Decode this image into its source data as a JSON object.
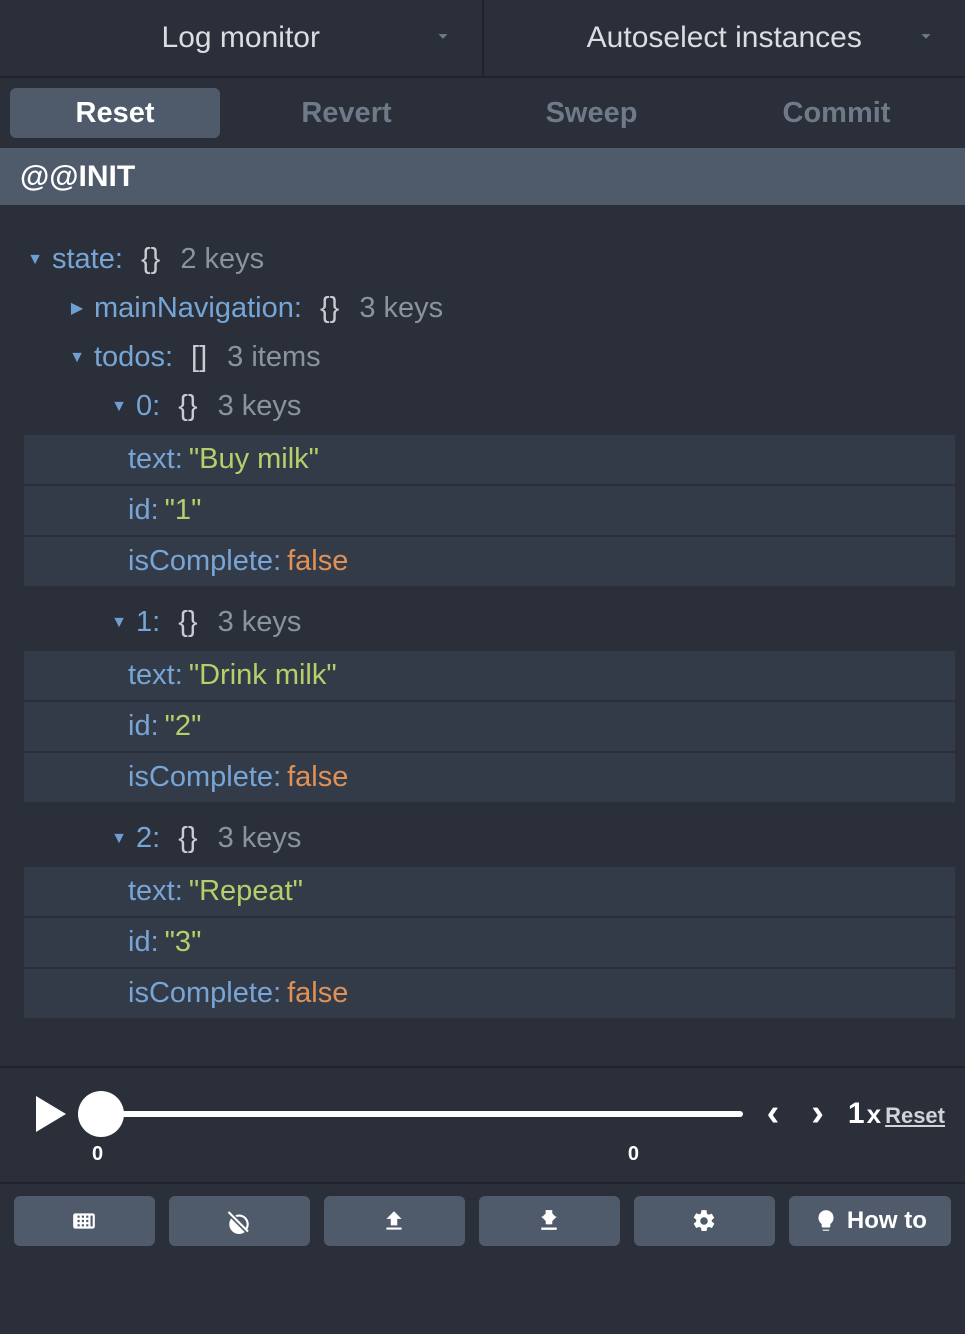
{
  "topSelectors": {
    "left": "Log monitor",
    "right": "Autoselect instances"
  },
  "actionRow": {
    "reset": "Reset",
    "revert": "Revert",
    "sweep": "Sweep",
    "commit": "Commit"
  },
  "actionTitle": "@@INIT",
  "tree": {
    "stateKey": "state",
    "stateBrace": "{}",
    "stateMeta": "2 keys",
    "mainNavKey": "mainNavigation",
    "mainNavBrace": "{}",
    "mainNavMeta": "3 keys",
    "todosKey": "todos",
    "todosBrace": "[]",
    "todosMeta": "3 items",
    "itemBrace": "{}",
    "itemMeta": "3 keys",
    "items": [
      {
        "idx": "0",
        "text": "\"Buy milk\"",
        "id": "\"1\"",
        "isComplete": "false"
      },
      {
        "idx": "1",
        "text": "\"Drink milk\"",
        "id": "\"2\"",
        "isComplete": "false"
      },
      {
        "idx": "2",
        "text": "\"Repeat\"",
        "id": "\"3\"",
        "isComplete": "false"
      }
    ],
    "labels": {
      "text": "text",
      "id": "id",
      "isComplete": "isComplete"
    }
  },
  "timeline": {
    "speed": "1",
    "speedX": "x",
    "reset": "Reset",
    "startLabel": "0",
    "endLabel": "0"
  },
  "bottomBar": {
    "howto": "How to"
  }
}
